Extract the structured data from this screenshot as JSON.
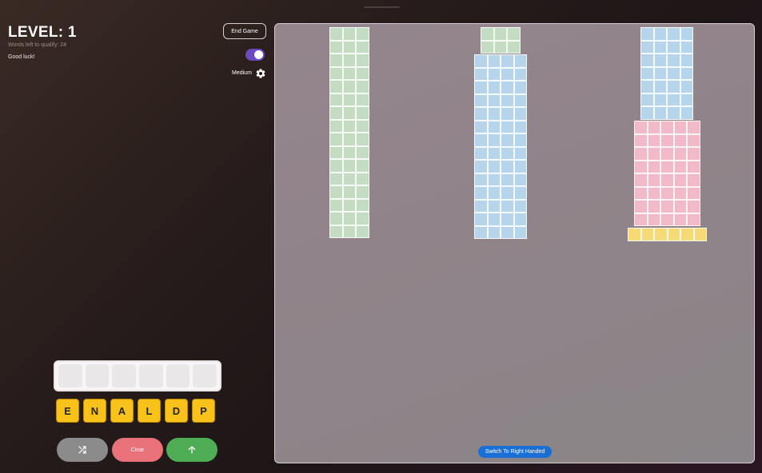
{
  "header": {
    "level_label": "LEVEL: 1",
    "words_left": "Words left to qualify: 24",
    "status_message": "Good luck!"
  },
  "controls": {
    "end_game_label": "End Game",
    "theme_icon": "moon-icon",
    "difficulty_label": "Medium",
    "settings_icon": "gear-icon"
  },
  "board": {
    "switch_hand_label": "Switch To Right Handed",
    "towers": [
      {
        "color": "#c4dcc2",
        "cols": 3,
        "rows": 16
      },
      {
        "color": "#c4dcc2",
        "cols": 3,
        "rows": 2
      },
      {
        "color": "#b6d4ec",
        "cols": 4,
        "rows": 14
      },
      {
        "color": "#b6d4ec",
        "cols": 4,
        "rows": 7
      },
      {
        "color": "#f2b9c8",
        "cols": 5,
        "rows": 8
      },
      {
        "color": "#f6da78",
        "cols": 6,
        "rows": 1
      }
    ]
  },
  "answer": {
    "slots": 6
  },
  "letters": [
    "E",
    "N",
    "A",
    "L",
    "D",
    "P"
  ],
  "actions": {
    "shuffle_icon": "shuffle-icon",
    "clear_label": "Clear",
    "submit_icon": "arrow-up-icon"
  }
}
